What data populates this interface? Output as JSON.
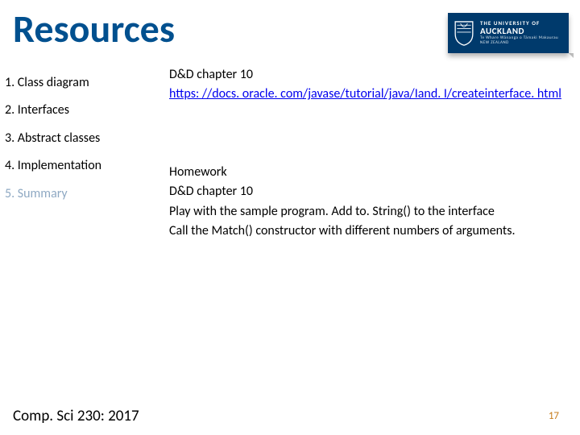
{
  "title": "Resources",
  "logo": {
    "line1": "THE UNIVERSITY OF",
    "line2": "AUCKLAND",
    "line3": "Te Whare Wānanga o Tāmaki Makaurau",
    "line4": "NEW ZEALAND"
  },
  "nav": {
    "items": [
      {
        "n": "1.",
        "label": "Class diagram",
        "current": false
      },
      {
        "n": "2.",
        "label": "Interfaces",
        "current": false
      },
      {
        "n": "3.",
        "label": "Abstract classes",
        "current": false
      },
      {
        "n": "4.",
        "label": "Implementation",
        "current": false
      },
      {
        "n": "5.",
        "label": "Summary",
        "current": true
      }
    ]
  },
  "content": {
    "dd": "D&D chapter 10",
    "link_text": "https: //docs. oracle. com/javase/tutorial/java/Iand. I/createinterface. html",
    "hw_title": "Homework",
    "hw_l1": "D&D chapter 10",
    "hw_l2": "Play with the sample program.  Add to. String() to the interface",
    "hw_l3": "Call the Match() constructor with different numbers of arguments."
  },
  "footer": "Comp. Sci 230: 2017",
  "page_number": "17"
}
